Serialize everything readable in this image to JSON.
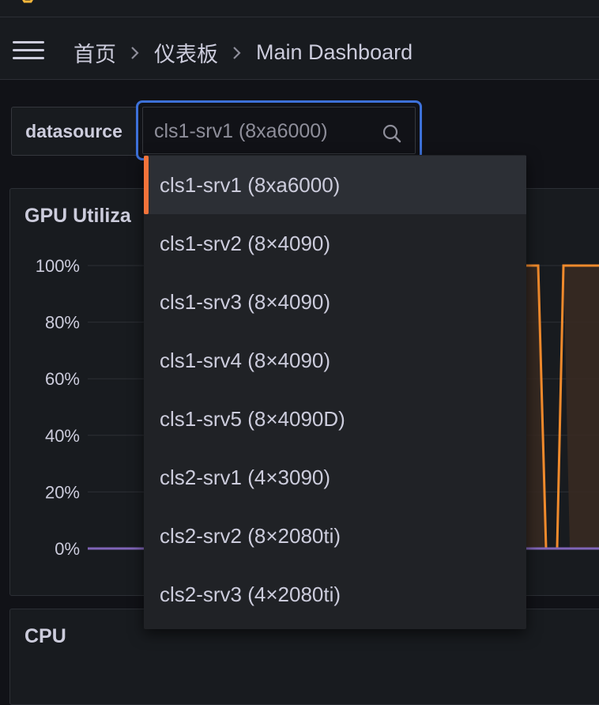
{
  "breadcrumb": {
    "items": [
      "首页",
      "仪表板",
      "Main Dashboard"
    ]
  },
  "variable": {
    "label": "datasource",
    "placeholder": "cls1-srv1 (8xa6000)"
  },
  "dropdown": {
    "options": [
      "cls1-srv1 (8xa6000)",
      "cls1-srv2 (8×4090)",
      "cls1-srv3 (8×4090)",
      "cls1-srv4 (8×4090)",
      "cls1-srv5 (8×4090D)",
      "cls2-srv1 (4×3090)",
      "cls2-srv2 (8×2080ti)",
      "cls2-srv3 (4×2080ti)"
    ],
    "selected_index": 0
  },
  "panels": {
    "gpu_title": "GPU Utiliza",
    "cpu_title": "CPU"
  },
  "colors": {
    "accent": "#f2733a",
    "focus": "#3d71d9",
    "series_orange": "#f08a2c",
    "series_purple": "#8065b8"
  },
  "chart_data": {
    "type": "line",
    "yticks": [
      "100%",
      "80%",
      "60%",
      "40%",
      "20%",
      "0%"
    ],
    "ylim": [
      0,
      100
    ],
    "grid": true,
    "series": [
      {
        "values_visible_right": [
          100,
          100,
          0,
          0,
          100,
          100,
          100
        ]
      },
      {
        "values": [
          0,
          0
        ]
      }
    ]
  }
}
